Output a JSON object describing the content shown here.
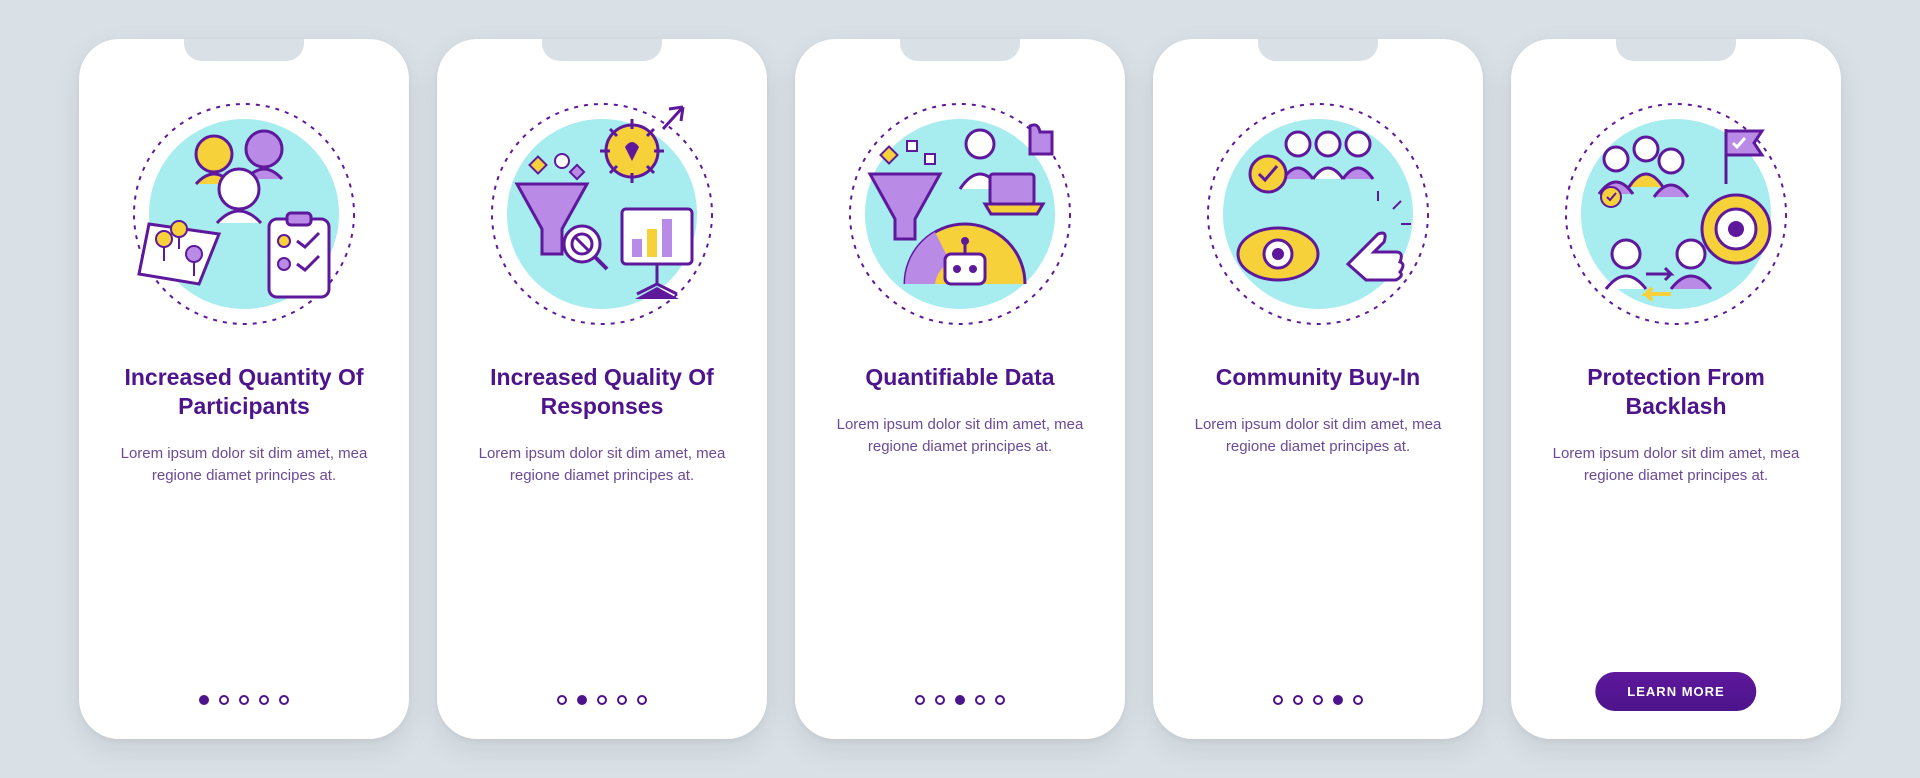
{
  "colors": {
    "purple": "#4d148c",
    "purpleLight": "#b98ae6",
    "yellow": "#f7d139",
    "cyan": "#a7ecef",
    "stroke": "#5e189c"
  },
  "cards": [
    {
      "title": "Increased Quantity Of Participants",
      "desc": "Lorem ipsum dolor sit dim amet, mea regione diamet principes at.",
      "icon": "participants-icon",
      "activeDot": 0
    },
    {
      "title": "Increased Quality Of Responses",
      "desc": "Lorem ipsum dolor sit dim amet, mea regione diamet principes at.",
      "icon": "quality-icon",
      "activeDot": 1
    },
    {
      "title": "Quantifiable Data",
      "desc": "Lorem ipsum dolor sit dim amet, mea regione diamet principes at.",
      "icon": "data-icon",
      "activeDot": 2
    },
    {
      "title": "Community Buy-In",
      "desc": "Lorem ipsum dolor sit dim amet, mea regione diamet principes at.",
      "icon": "community-icon",
      "activeDot": 3
    },
    {
      "title": "Protection From Backlash",
      "desc": "Lorem ipsum dolor sit dim amet, mea regione diamet principes at.",
      "icon": "protection-icon",
      "activeDot": 4,
      "cta": "LEARN MORE"
    }
  ],
  "totalDots": 5
}
